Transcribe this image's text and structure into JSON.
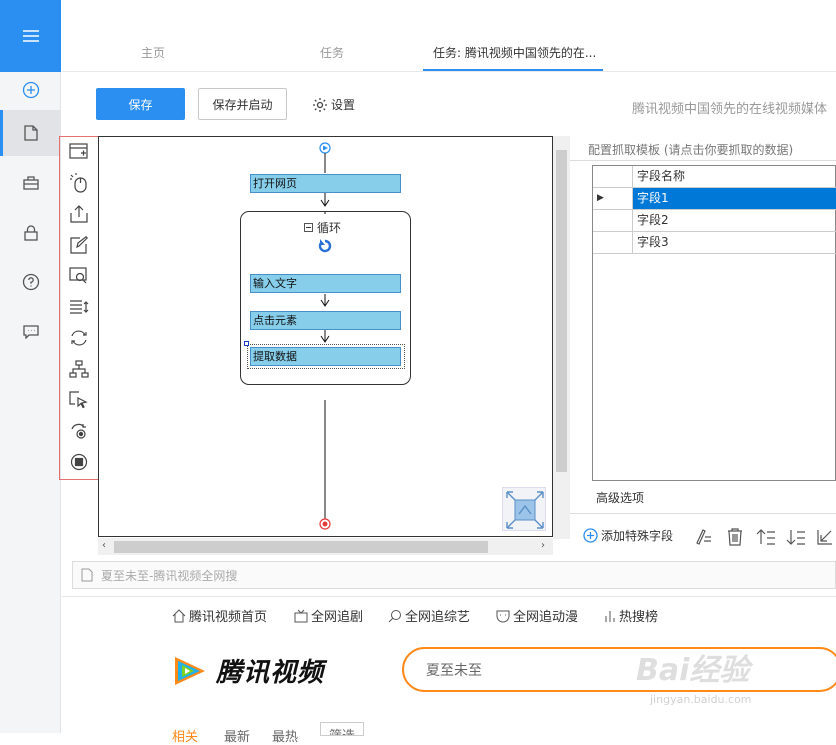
{
  "tabs": [
    {
      "label": "主页"
    },
    {
      "label": "任务"
    },
    {
      "label": "任务: 腾讯视频中国领先的在..."
    }
  ],
  "toolbar": {
    "save_label": "保存",
    "save_start_label": "保存并启动",
    "settings_label": "设置",
    "task_title": "腾讯视频中国领先的在线视频媒体"
  },
  "flow": {
    "open_page": "打开网页",
    "loop": "循环",
    "input_text": "输入文字",
    "click_element": "点击元素",
    "extract_data": "提取数据"
  },
  "config": {
    "title": "配置抓取模板 (请点击你要抓取的数据)",
    "column_header": "字段名称",
    "fields": [
      "字段1",
      "字段2",
      "字段3"
    ],
    "advanced": "高级选项",
    "add_special_field": "添加特殊字段"
  },
  "browser": {
    "url_title": "夏至未至-腾讯视频全网搜",
    "nav": [
      "腾讯视频首页",
      "全网追剧",
      "全网追综艺",
      "全网追动漫",
      "热搜榜"
    ],
    "logo_text": "腾讯视频",
    "search_value": "夏至未至",
    "tabs": [
      "相关",
      "最新",
      "最热",
      "筛选"
    ]
  },
  "watermark": {
    "main": "Bai经验",
    "sub": "jingyan.baidu.com"
  },
  "colors": {
    "accent": "#2a8ff0",
    "step_fill": "#87ceeb",
    "highlight": "#e53a3a",
    "search_border": "#ff8a1a"
  }
}
